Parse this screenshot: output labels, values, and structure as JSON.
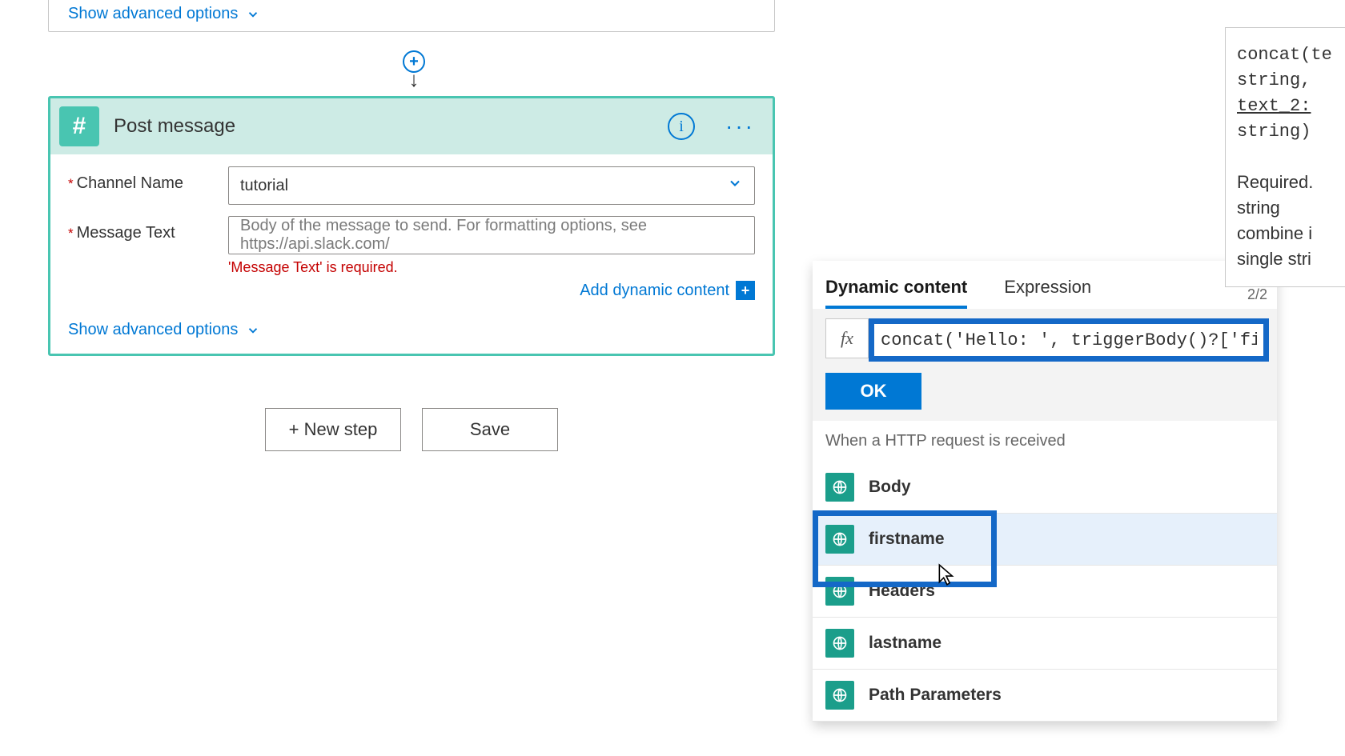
{
  "top_card": {
    "advanced_label": "Show advanced options"
  },
  "action": {
    "title": "Post message",
    "app_icon": "hash-icon",
    "fields": {
      "channel": {
        "label": "Channel Name",
        "value": "tutorial"
      },
      "message": {
        "label": "Message Text",
        "placeholder": "Body of the message to send. For formatting options, see https://api.slack.com/",
        "error": "'Message Text' is required."
      }
    },
    "add_dynamic": "Add dynamic content",
    "advanced_label": "Show advanced options"
  },
  "buttons": {
    "new_step": "+ New step",
    "save": "Save"
  },
  "dynpanel": {
    "tab_dynamic": "Dynamic content",
    "tab_expression": "Expression",
    "pager": "2/2",
    "fx_label": "fx",
    "expression": "concat('Hello: ', triggerBody()?['firstnam",
    "ok": "OK",
    "source_title": "When a HTTP request is received",
    "items": [
      {
        "label": "Body"
      },
      {
        "label": "firstname"
      },
      {
        "label": "Headers"
      },
      {
        "label": "lastname"
      },
      {
        "label": "Path Parameters"
      }
    ]
  },
  "tooltip": {
    "line1": "concat(te",
    "line2": "string,",
    "line3": "text_2:",
    "line4": "string)",
    "desc1": "Required.",
    "desc2": "string",
    "desc3": "combine i",
    "desc4": "single stri"
  }
}
